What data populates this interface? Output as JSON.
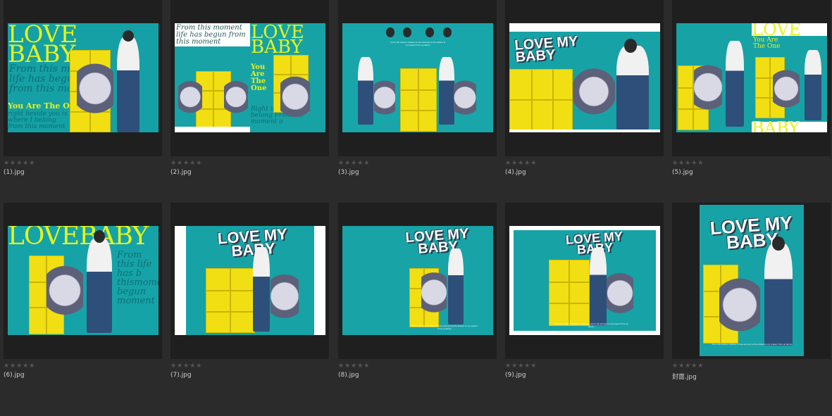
{
  "items": [
    {
      "filename": "(1).jpg",
      "rating_stars": "★★★★★",
      "thumb": {
        "kind": "poster-left",
        "big_text": "LOVE BABY",
        "small_text": "From this m life has begu from this mo",
        "accent_text": "You Are The One",
        "extra_text": "right beside you is where I belong from this moment"
      }
    },
    {
      "filename": "(2).jpg",
      "rating_stars": "★★★★★",
      "thumb": {
        "kind": "split",
        "left_text": "From this moment life has begun from this moment",
        "big_text": "LOVE BABY",
        "accent_text": "You Are The One",
        "extra_text": "Right is where I belong From the moment o"
      }
    },
    {
      "filename": "(3).jpg",
      "rating_stars": "★★★★★",
      "thumb": {
        "kind": "group",
        "small_caption": "You're the reason I believe in love and you're the answer to my prayers from up above"
      }
    },
    {
      "filename": "(4).jpg",
      "rating_stars": "★★★★★",
      "thumb": {
        "kind": "love-my-baby-wide",
        "big_text": "LOVE MY BABY"
      }
    },
    {
      "filename": "(5).jpg",
      "rating_stars": "★★★★★",
      "thumb": {
        "kind": "double",
        "big_text": "LOVE",
        "accent_text": "You Are The One",
        "bottom_text": "BABY"
      }
    },
    {
      "filename": "(6).jpg",
      "rating_stars": "★★★★★",
      "thumb": {
        "kind": "lovebaby-banner",
        "big_text": "LOVEBABY",
        "small_text": "From this life has b thismomen begun moment"
      }
    },
    {
      "filename": "(7).jpg",
      "rating_stars": "★★★★★",
      "thumb": {
        "kind": "love-my-baby-white-border",
        "big_text": "LOVE MY BABY"
      }
    },
    {
      "filename": "(8).jpg",
      "rating_stars": "★★★★★",
      "thumb": {
        "kind": "love-my-baby-center",
        "big_text": "LOVE MY BABY",
        "small_caption": "You're the reason I believe in love and you're the answer to my prayers from up above"
      }
    },
    {
      "filename": "(9).jpg",
      "rating_stars": "★★★★★",
      "thumb": {
        "kind": "love-my-baby-framed",
        "big_text": "LOVE MY BABY",
        "small_caption": "You're the reason I believe in love and you're the answer to my prayers from up above"
      }
    },
    {
      "filename": "封面.jpg",
      "rating_stars": "★★★★★",
      "thumb": {
        "kind": "cover-portrait",
        "big_text": "LOVE MY BABY",
        "small_caption": "You're the reason I believe in love and you're the answer to my prayers from up above"
      }
    }
  ],
  "colors": {
    "background": "#2b2b2b",
    "cell": "#1f1f1f",
    "teal": "#17a2a6",
    "yellow": "#e6f31b",
    "shelf": "#f2df13"
  }
}
